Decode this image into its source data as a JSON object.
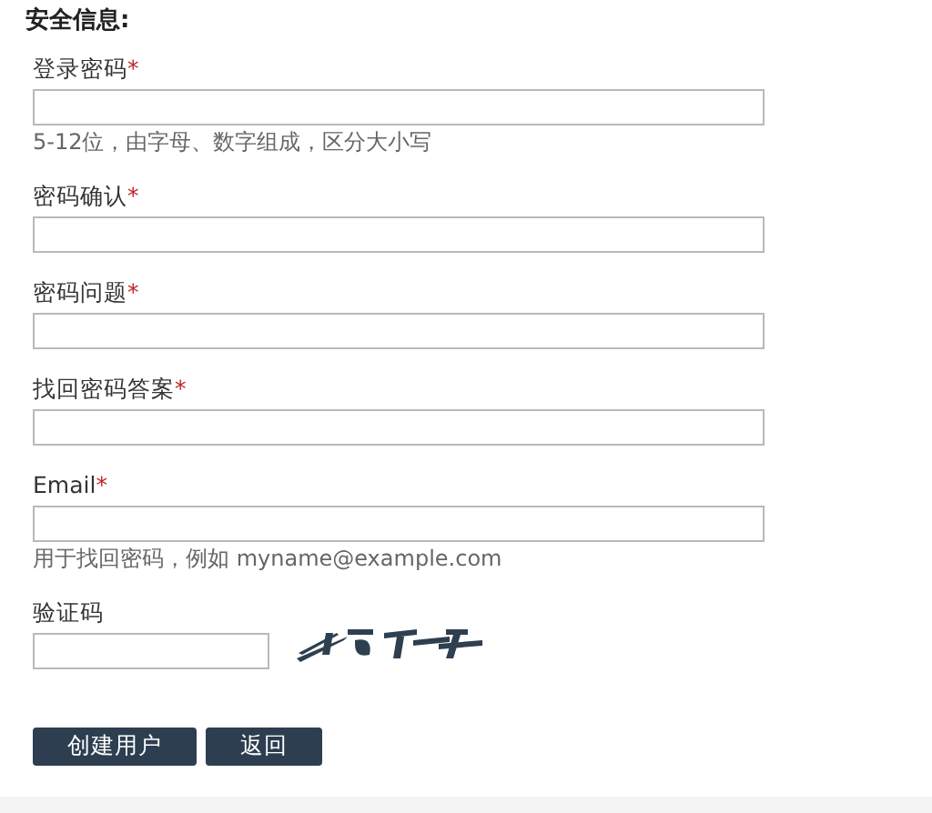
{
  "section_title": "安全信息:",
  "fields": [
    {
      "kind": "text",
      "label": "登录密码",
      "marker": "*",
      "hint": "5-12位，由字母、数字组成，区分大小写"
    },
    {
      "kind": "text",
      "label": "密码确认",
      "marker": "*"
    },
    {
      "kind": "text",
      "label": "密码问题",
      "marker": "*"
    },
    {
      "kind": "text",
      "label": "找回密码答案",
      "marker": "*"
    },
    {
      "kind": "text",
      "label": "Email",
      "marker": "*",
      "hint": "用于找回密码，例如 myname@example.com"
    },
    {
      "kind": "captcha",
      "label": "验证码"
    }
  ],
  "buttons": [
    "创建用户",
    "返回"
  ]
}
